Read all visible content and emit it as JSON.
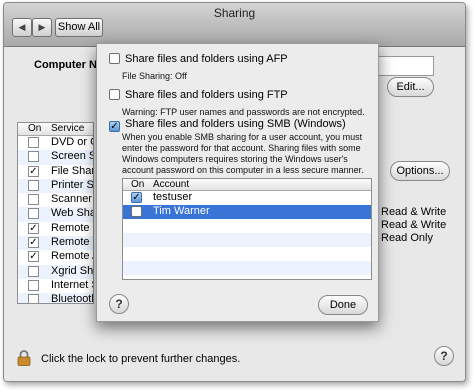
{
  "window": {
    "title": "Sharing",
    "back_icon": "◀",
    "forward_icon": "▶",
    "show_all_label": "Show All"
  },
  "computer_name": {
    "label": "Computer Na",
    "edit_label": "Edit..."
  },
  "services": {
    "col_on": "On",
    "col_service": "Service",
    "items": [
      {
        "label": "DVD or CD",
        "checked": false
      },
      {
        "label": "Screen Sha",
        "checked": false
      },
      {
        "label": "File Sharing",
        "checked": true
      },
      {
        "label": "Printer Sha",
        "checked": false
      },
      {
        "label": "Scanner Sh",
        "checked": false
      },
      {
        "label": "Web Sharin",
        "checked": false
      },
      {
        "label": "Remote Lo",
        "checked": true
      },
      {
        "label": "Remote Ma",
        "checked": true
      },
      {
        "label": "Remote Ap",
        "checked": true
      },
      {
        "label": "Xgrid Sharir",
        "checked": false
      },
      {
        "label": "Internet Sh",
        "checked": false
      },
      {
        "label": "Bluetooth S",
        "checked": false
      }
    ]
  },
  "options_label": "Options...",
  "permissions": [
    "Read & Write",
    "Read & Write",
    "Read Only"
  ],
  "lock_text": "Click the lock to prevent further changes.",
  "help_label": "?",
  "sheet": {
    "afp": {
      "label": "Share files and folders using AFP",
      "checked": false,
      "status": "File Sharing: Off"
    },
    "ftp": {
      "label": "Share files and folders using FTP",
      "checked": false,
      "warning": "Warning: FTP user names and passwords are not encrypted."
    },
    "smb": {
      "label": "Share files and folders using SMB (Windows)",
      "checked": true,
      "info": "When you enable SMB sharing for a user account, you must enter the password for that account. Sharing files with some Windows computers requires storing the Windows user's account password on this computer in a less secure manner."
    },
    "accounts": {
      "col_on": "On",
      "col_account": "Account",
      "rows": [
        {
          "name": "testuser",
          "checked": true,
          "selected": false
        },
        {
          "name": "Tim Warner",
          "checked": false,
          "selected": true
        }
      ]
    },
    "help_label": "?",
    "done_label": "Done"
  },
  "colors": {
    "selection": "#3875d7",
    "alt_row": "#edf3fe"
  }
}
